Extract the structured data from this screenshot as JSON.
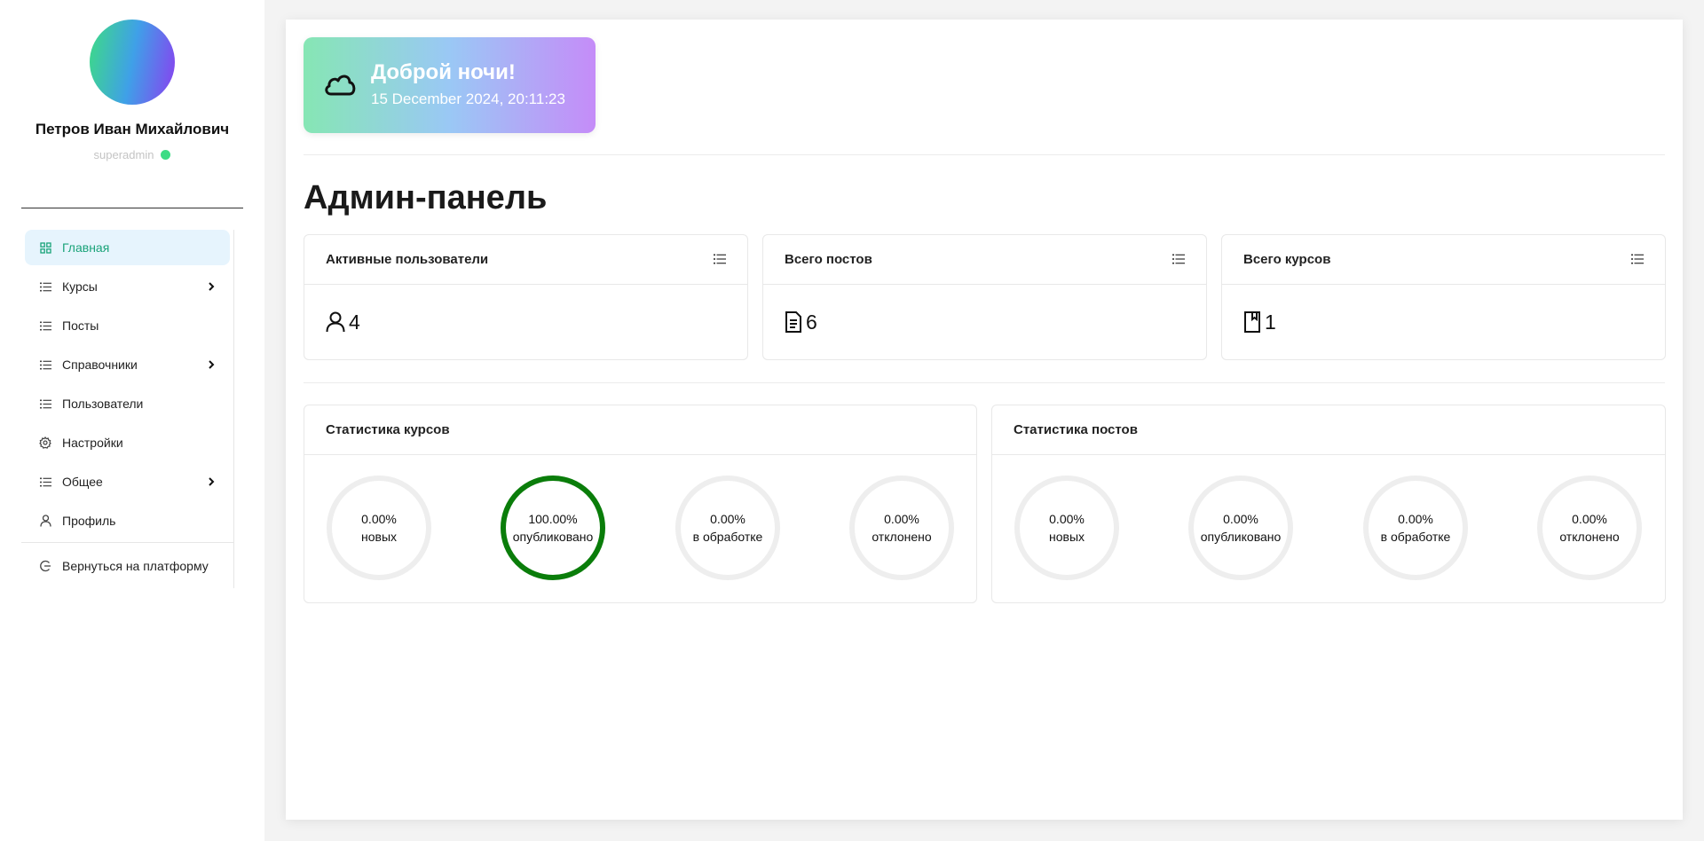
{
  "user": {
    "name": "Петров Иван Михайлович",
    "role": "superadmin",
    "online_color": "#3ddc84"
  },
  "nav": {
    "items": [
      {
        "label": "Главная",
        "icon": "grid-icon",
        "active": true
      },
      {
        "label": "Курсы",
        "icon": "list-icon",
        "expandable": true
      },
      {
        "label": "Посты",
        "icon": "list-icon"
      },
      {
        "label": "Справочники",
        "icon": "list-icon",
        "expandable": true
      },
      {
        "label": "Пользователи",
        "icon": "list-icon"
      },
      {
        "label": "Настройки",
        "icon": "gear-icon"
      },
      {
        "label": "Общее",
        "icon": "list-icon",
        "expandable": true
      },
      {
        "label": "Профиль",
        "icon": "user-icon"
      }
    ],
    "back_label": "Вернуться на платформу"
  },
  "greeting": {
    "title": "Доброй ночи!",
    "datetime": "15 December 2024, 20:11:23"
  },
  "page_title": "Админ-панель",
  "summary": [
    {
      "title": "Активные пользователи",
      "value": "4",
      "icon": "user-icon"
    },
    {
      "title": "Всего постов",
      "value": "6",
      "icon": "document-icon"
    },
    {
      "title": "Всего курсов",
      "value": "1",
      "icon": "book-icon"
    }
  ],
  "stats": [
    {
      "title": "Статистика курсов",
      "items": [
        {
          "pct": "0.00%",
          "label": "новых",
          "fraction": 0
        },
        {
          "pct": "100.00%",
          "label": "опубликовано",
          "fraction": 1,
          "color": "#0a7d0a"
        },
        {
          "pct": "0.00%",
          "label": "в обработке",
          "fraction": 0
        },
        {
          "pct": "0.00%",
          "label": "отклонено",
          "fraction": 0
        }
      ]
    },
    {
      "title": "Статистика постов",
      "items": [
        {
          "pct": "0.00%",
          "label": "новых",
          "fraction": 0
        },
        {
          "pct": "0.00%",
          "label": "опубликовано",
          "fraction": 0
        },
        {
          "pct": "0.00%",
          "label": "в обработке",
          "fraction": 0
        },
        {
          "pct": "0.00%",
          "label": "отклонено",
          "fraction": 0
        }
      ]
    }
  ],
  "colors": {
    "accent": "#1aa37a",
    "active_bg": "#e6f4fd",
    "ring_track": "#eeeeee"
  }
}
